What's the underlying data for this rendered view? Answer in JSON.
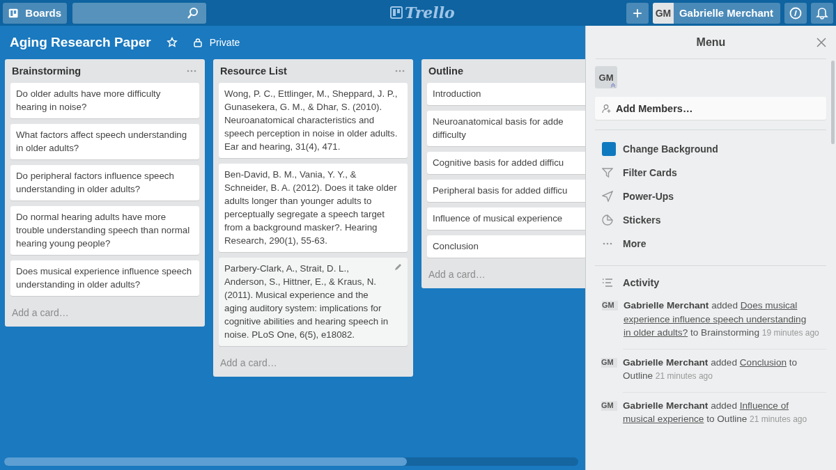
{
  "header": {
    "boards_label": "Boards",
    "add_label": "+",
    "logo": "Trello",
    "user_initials": "GM",
    "user_name": "Gabrielle Merchant"
  },
  "board": {
    "title": "Aging Research Paper",
    "starred": false,
    "visibility": "Private"
  },
  "lists": [
    {
      "title": "Brainstorming",
      "cards": [
        {
          "text": "Do older adults have more difficulty hearing in noise?"
        },
        {
          "text": "What factors affect speech understanding in older adults?"
        },
        {
          "text": "Do peripheral factors influence speech understanding in older adults?"
        },
        {
          "text": "Do normal hearing adults have more trouble understanding speech than normal hearing young people?"
        },
        {
          "text": "Does musical experience influence speech understanding in older adults?"
        }
      ],
      "add_card": "Add a card…"
    },
    {
      "title": "Resource List",
      "cards": [
        {
          "text": "Wong, P. C., Ettlinger, M., Sheppard, J. P., Gunasekera, G. M., & Dhar, S. (2010). Neuroanatomical characteristics and speech perception in noise in older adults. Ear and hearing, 31(4), 471."
        },
        {
          "text": "Ben-David, B. M., Vania, Y. Y., & Schneider, B. A. (2012). Does it take older adults longer than younger adults to perceptually segregate a speech target from a background masker?. Hearing Research, 290(1), 55-63."
        },
        {
          "text": "Parbery-Clark, A., Strait, D. L., Anderson, S., Hittner, E., & Kraus, N. (2011). Musical experience and the aging auditory system: implications for cognitive abilities and hearing speech in noise. PLoS One, 6(5), e18082.",
          "hovered": true
        }
      ],
      "add_card": "Add a card…"
    },
    {
      "title": "Outline",
      "cards": [
        {
          "text": "Introduction"
        },
        {
          "text": "Neuroanatomical basis for adde\ndifficulty"
        },
        {
          "text": "Cognitive basis for added difficu"
        },
        {
          "text": "Peripheral basis for added difficu"
        },
        {
          "text": "Influence of musical experience"
        },
        {
          "text": "Conclusion"
        }
      ],
      "add_card": "Add a card…"
    }
  ],
  "menu": {
    "title": "Menu",
    "member_initials": "GM",
    "add_members": "Add Members…",
    "items": [
      {
        "kind": "background",
        "label": "Change Background",
        "color": "#0f79bf"
      },
      {
        "kind": "filter",
        "label": "Filter Cards"
      },
      {
        "kind": "powerups",
        "label": "Power-Ups"
      },
      {
        "kind": "stickers",
        "label": "Stickers"
      },
      {
        "kind": "more",
        "label": "More"
      }
    ],
    "activity_title": "Activity",
    "activity": [
      {
        "initials": "GM",
        "member": "Gabrielle Merchant",
        "action": "added",
        "card": [
          "Does musical",
          "experience influence speech understanding",
          "in older adults?"
        ],
        "preposition": "to",
        "list": "Brainstorming",
        "time": "19 minutes ago"
      },
      {
        "initials": "GM",
        "member": "Gabrielle Merchant",
        "action": "added",
        "card": [
          "Conclusion"
        ],
        "preposition": "to",
        "list": "Outline",
        "time": "21 minutes ago"
      },
      {
        "initials": "GM",
        "member": "Gabrielle Merchant",
        "action": "added",
        "card": [
          "Influence of",
          "musical experience"
        ],
        "preposition": "to",
        "list": "Outline",
        "time": "21 minutes ago"
      }
    ]
  }
}
